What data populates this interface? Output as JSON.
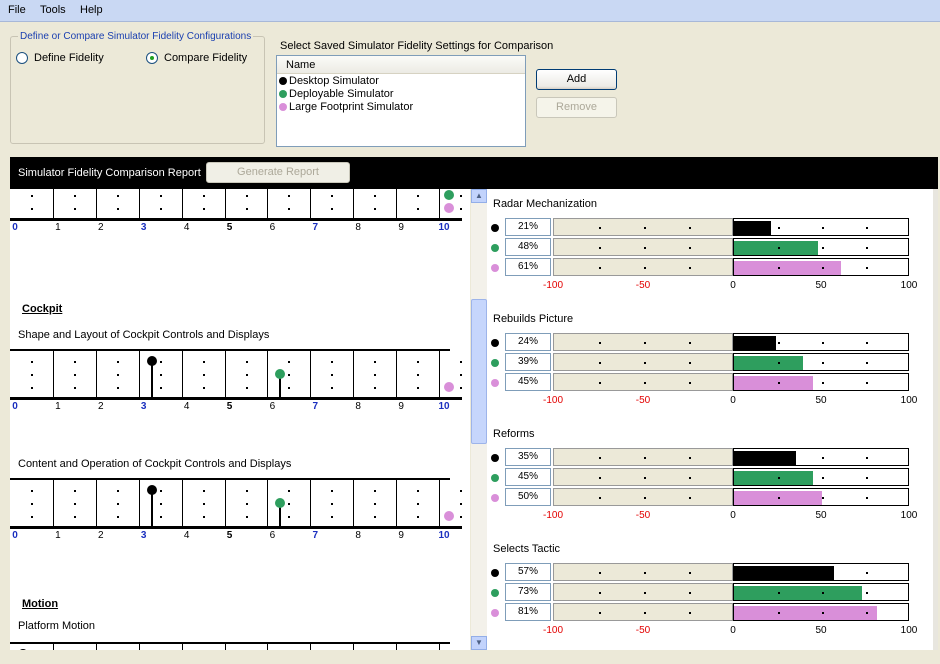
{
  "menu": {
    "file": "File",
    "tools": "Tools",
    "help": "Help"
  },
  "config": {
    "group_title": "Define or Compare Simulator Fidelity Configurations",
    "define_label": "Define Fidelity",
    "compare_label": "Compare Fidelity",
    "selected": "compare"
  },
  "saved": {
    "title": "Select Saved Simulator Fidelity Settings for Comparison",
    "column": "Name",
    "items": [
      {
        "label": "Desktop Simulator",
        "color": "#000000"
      },
      {
        "label": "Deployable Simulator",
        "color": "#2e9e5e"
      },
      {
        "label": "Large Footprint Simulator",
        "color": "#d98fd9"
      }
    ],
    "add_label": "Add",
    "remove_label": "Remove"
  },
  "report": {
    "title": "Simulator Fidelity Comparison Report",
    "generate_label": "Generate Report"
  },
  "colors": {
    "sim1": "#000000",
    "sim2": "#2e9e5e",
    "sim3": "#d98fd9"
  },
  "fidelity": {
    "axis_labels": [
      "0",
      "1",
      "2",
      "3",
      "4",
      "5",
      "6",
      "7",
      "8",
      "9",
      "10"
    ],
    "top_partial": {
      "values": [
        10,
        10,
        10
      ]
    },
    "cockpit_section": "Cockpit",
    "items": [
      {
        "title": "Shape and Layout of Cockpit Controls and Displays",
        "values": [
          3,
          6,
          10
        ]
      },
      {
        "title": "Content and Operation of Cockpit Controls and Displays",
        "values": [
          3,
          6,
          10
        ]
      }
    ],
    "motion_section": "Motion",
    "motion_item": {
      "title": "Platform Motion",
      "values": [
        0
      ]
    }
  },
  "comparison": {
    "scale_labels": [
      "-100",
      "-50",
      "0",
      "50",
      "100"
    ],
    "categories": [
      {
        "name": "Radar Mechanization",
        "values": [
          21,
          48,
          61
        ],
        "labels": [
          "21%",
          "48%",
          "61%"
        ]
      },
      {
        "name": "Rebuilds Picture",
        "values": [
          24,
          39,
          45
        ],
        "labels": [
          "24%",
          "39%",
          "45%"
        ]
      },
      {
        "name": "Reforms",
        "values": [
          35,
          45,
          50
        ],
        "labels": [
          "35%",
          "45%",
          "50%"
        ]
      },
      {
        "name": "Selects Tactic",
        "values": [
          57,
          73,
          81
        ],
        "labels": [
          "57%",
          "73%",
          "81%"
        ]
      }
    ]
  }
}
